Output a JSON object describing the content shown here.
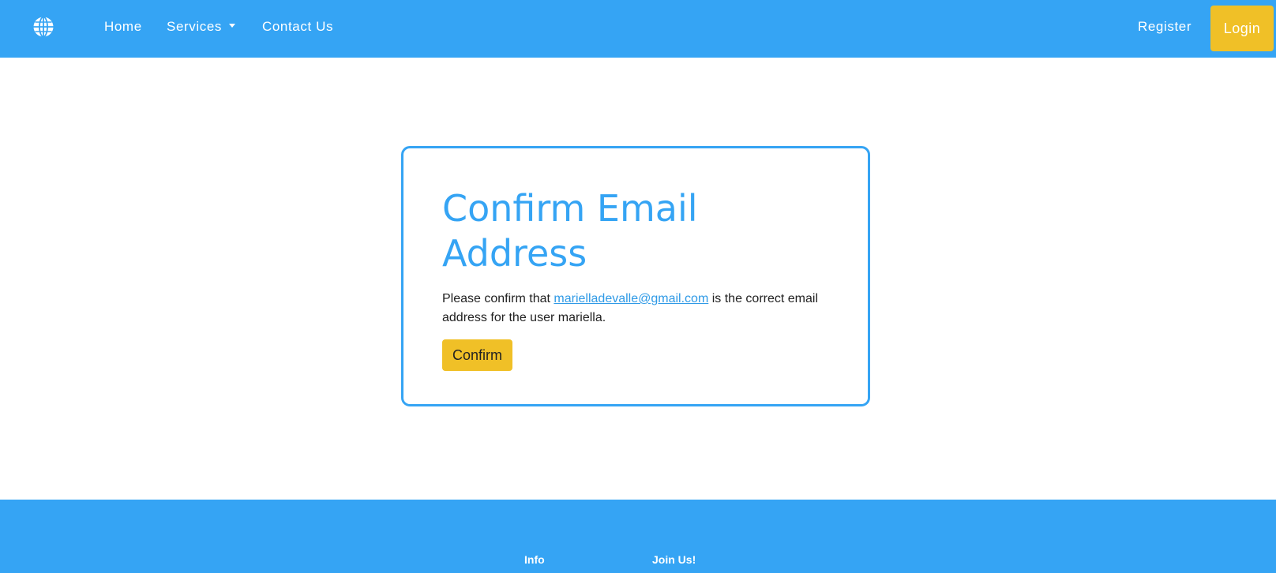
{
  "navbar": {
    "brand_icon": "globe-icon",
    "links": {
      "home": "Home",
      "services": "Services",
      "contact": "Contact Us"
    },
    "register": "Register",
    "login": "Login",
    "background_color": "#35a4f4",
    "accent_color": "#f0c027"
  },
  "card": {
    "title": "Confirm Email Address",
    "text_before": "Please confirm that ",
    "email": "marielladevalle@gmail.com",
    "text_after": " is the correct email address for the user mariella.",
    "confirm_label": "Confirm"
  },
  "footer": {
    "info_heading": "Info",
    "join_heading": "Join Us!"
  }
}
